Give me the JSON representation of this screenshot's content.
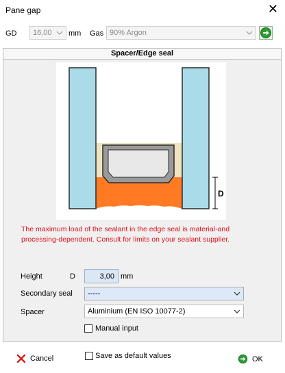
{
  "window": {
    "title": "Pane gap"
  },
  "top": {
    "gd_label": "GD",
    "gd_value": "16,00",
    "gd_unit": "mm",
    "gas_label": "Gas",
    "gas_value": "90% Argon"
  },
  "panel": {
    "title": "Spacer/Edge seal",
    "diagram_dim_label": "D",
    "warning": "The maximum load of the sealant in the edge seal is material-and processing-dependent. Consult for limits on your sealant supplier."
  },
  "form": {
    "height_label": "Height",
    "height_symbol": "D",
    "height_value": "3,00",
    "height_unit": "mm",
    "secondary_seal_label": "Secondary seal",
    "secondary_seal_value": "-----",
    "spacer_label": "Spacer",
    "spacer_value": "Aluminium (EN ISO 10077-2)",
    "manual_input_label": "Manual input"
  },
  "footer": {
    "cancel_label": "Cancel",
    "save_default_label": "Save as default values",
    "ok_label": "OK"
  },
  "colors": {
    "glass": "#a9dbe8",
    "sealant": "#ff7a22",
    "butyl": "#efe4bf",
    "spacer": "#9a9a9a",
    "warning_text": "#e0101c",
    "go_green": "#2f9a35"
  }
}
